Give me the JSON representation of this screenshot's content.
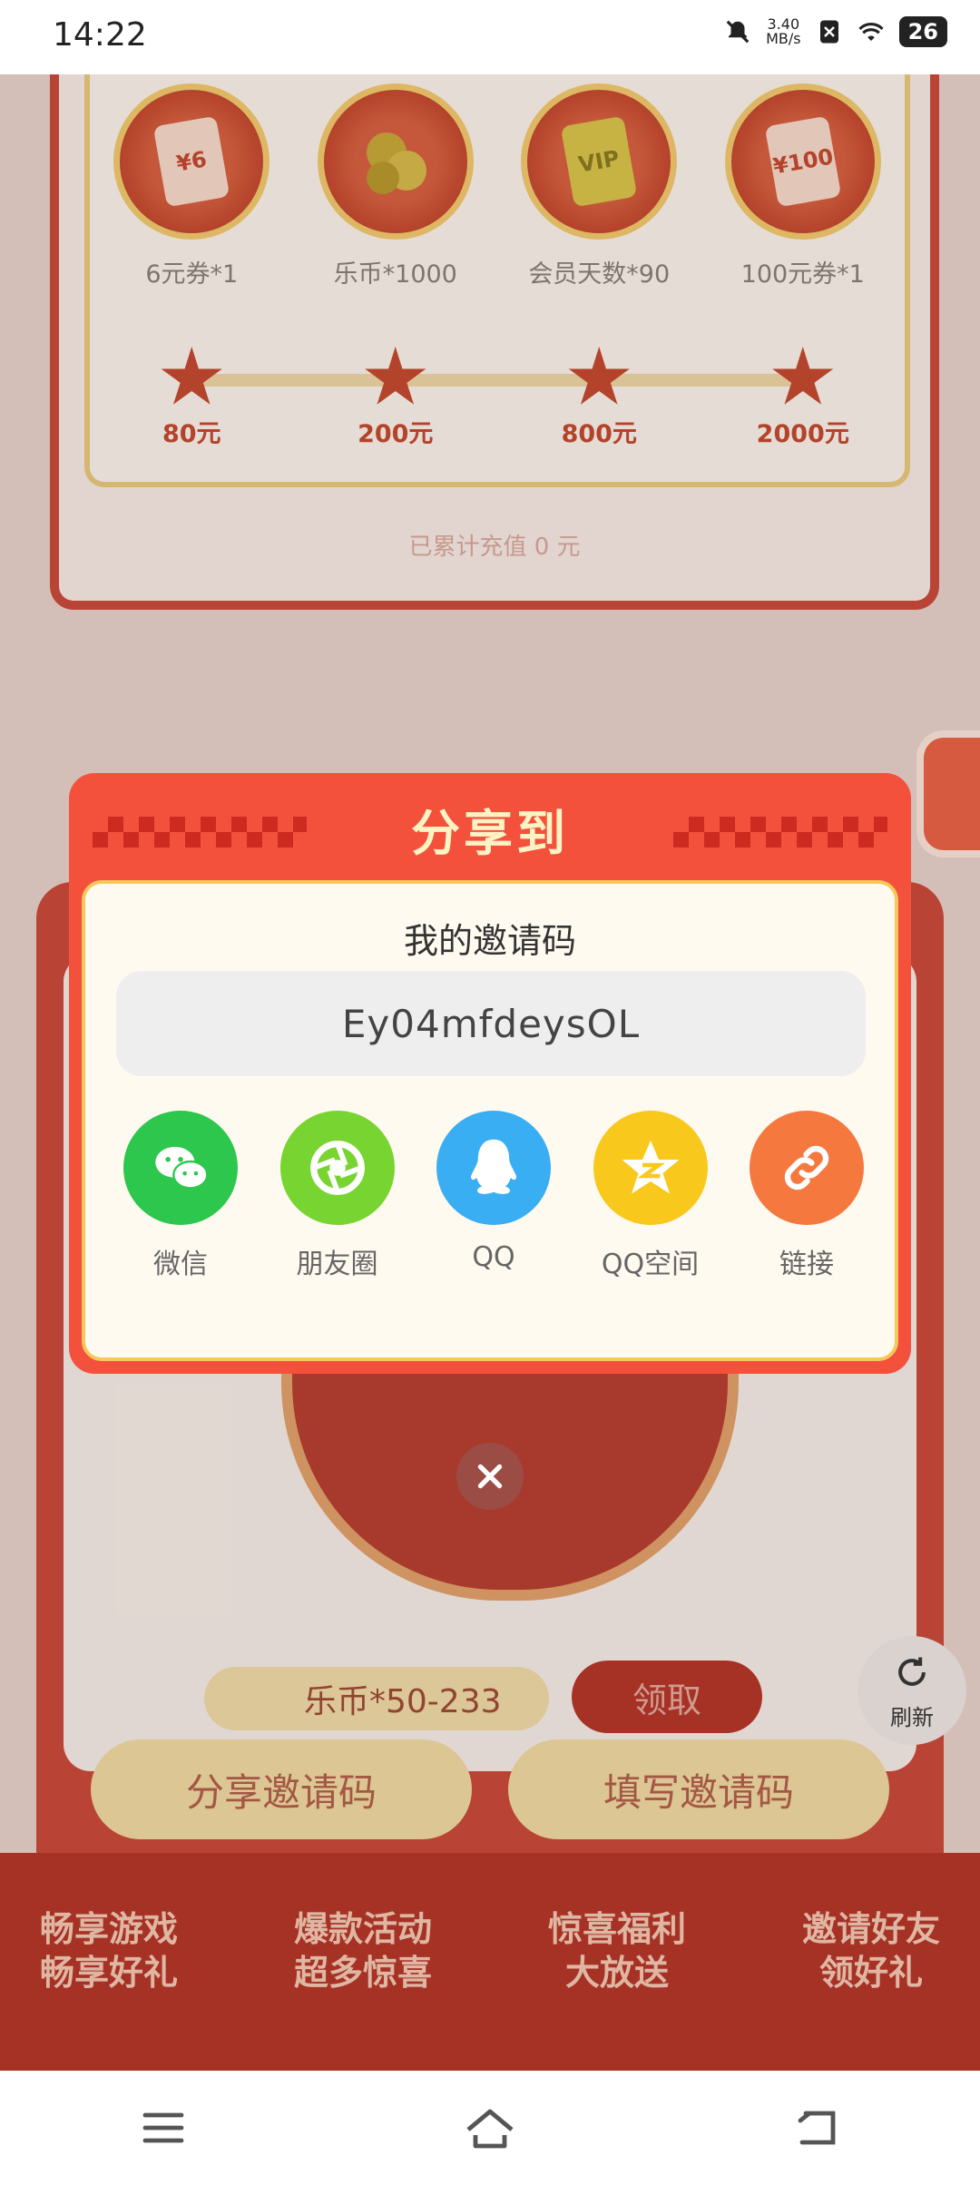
{
  "status_bar": {
    "time": "14:22",
    "net_speed_value": "3.40",
    "net_speed_unit": "MB/s",
    "battery": "26"
  },
  "background": {
    "prizes": [
      {
        "icon": "coupon-6-icon",
        "icon_text": "¥6",
        "label": "6元券*1"
      },
      {
        "icon": "coins-icon",
        "icon_text": "",
        "label": "乐币*1000"
      },
      {
        "icon": "vip-card-icon",
        "icon_text": "VIP",
        "label": "会员天数*90"
      },
      {
        "icon": "coupon-100-icon",
        "icon_text": "¥100",
        "label": "100元券*1"
      }
    ],
    "milestones": [
      "80元",
      "200元",
      "800元",
      "2000元"
    ],
    "recharge_text": "已累计充值 0 元",
    "coin_reward": "乐币*50-233",
    "claim_label": "领取",
    "share_code_button": "分享邀请码",
    "fill_code_button": "填写邀请码",
    "banners": [
      {
        "line1": "畅享游戏",
        "line2": "畅享好礼"
      },
      {
        "line1": "爆款活动",
        "line2": "超多惊喜"
      },
      {
        "line1": "惊喜福利",
        "line2": "大放送"
      },
      {
        "line1": "邀请好友",
        "line2": "领好礼"
      }
    ],
    "refresh_label": "刷新"
  },
  "modal": {
    "title": "分享到",
    "code_label": "我的邀请码",
    "invite_code": "Ey04mfdeysOL",
    "share_targets": [
      {
        "id": "wechat",
        "label": "微信",
        "color": "#2dc74d",
        "icon": "wechat-icon"
      },
      {
        "id": "moments",
        "label": "朋友圈",
        "color": "#78d431",
        "icon": "moments-icon"
      },
      {
        "id": "qq",
        "label": "QQ",
        "color": "#3aaef3",
        "icon": "qq-icon"
      },
      {
        "id": "qzone",
        "label": "QQ空间",
        "color": "#f9c81d",
        "icon": "qzone-icon"
      },
      {
        "id": "link",
        "label": "链接",
        "color": "#f5793f",
        "icon": "link-icon"
      }
    ]
  },
  "colors": {
    "modal_red": "#f4513c",
    "modal_body": "#fffaf0",
    "title_yellow": "#fff3c4"
  }
}
